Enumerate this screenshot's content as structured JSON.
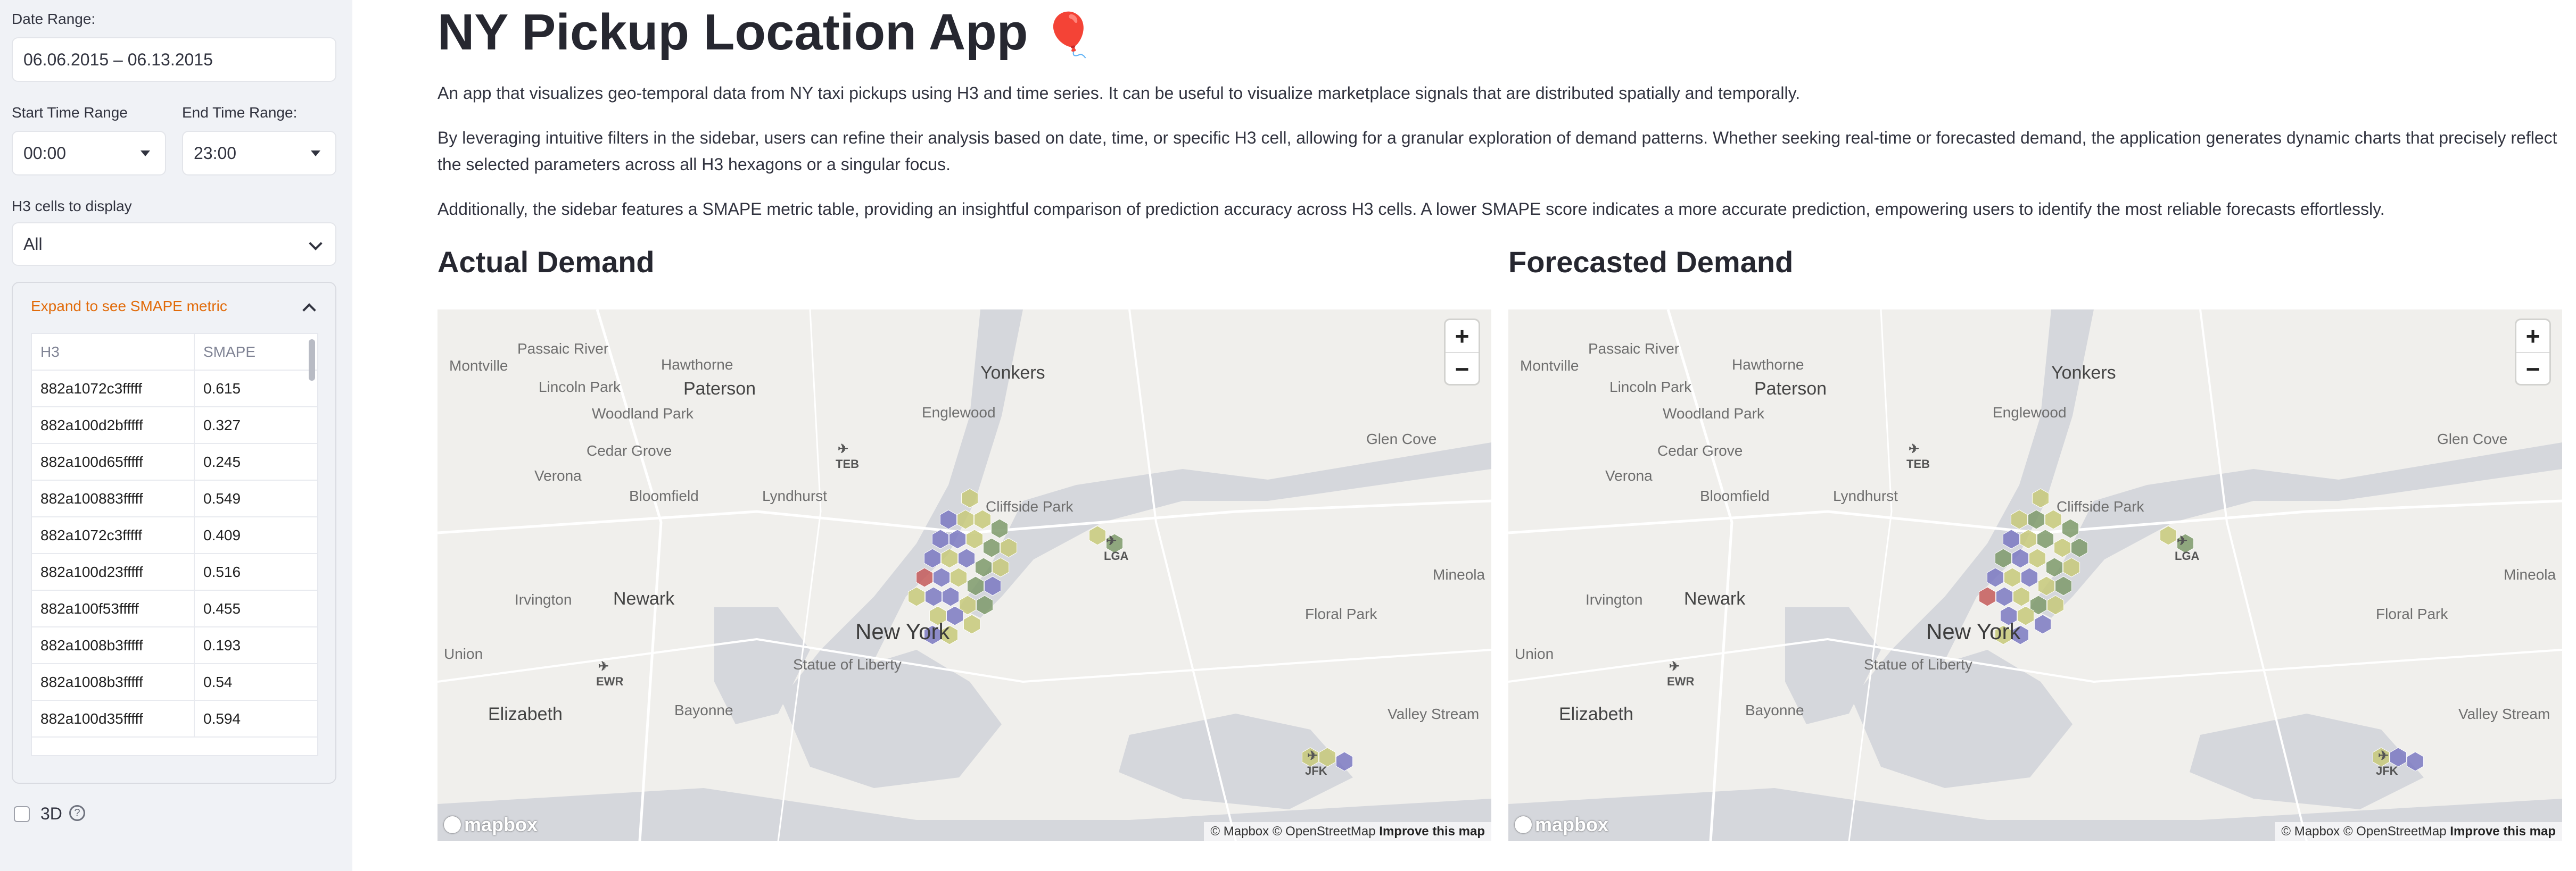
{
  "sidebar": {
    "date_range_label": "Date Range:",
    "date_range_value": "06.06.2015 – 06.13.2015",
    "start_time_label": "Start Time Range",
    "start_time_value": "00:00",
    "end_time_label": "End Time Range:",
    "end_time_value": "23:00",
    "h3_cells_label": "H3 cells to display",
    "h3_cells_value": "All",
    "expander_title": "Expand to see SMAPE metric",
    "table_headers": [
      "H3",
      "SMAPE"
    ],
    "table_rows": [
      [
        "882a1072c3fffff",
        "0.615"
      ],
      [
        "882a100d2bfffff",
        "0.327"
      ],
      [
        "882a100d65fffff",
        "0.245"
      ],
      [
        "882a100883fffff",
        "0.549"
      ],
      [
        "882a1072c3fffff",
        "0.409"
      ],
      [
        "882a100d23fffff",
        "0.516"
      ],
      [
        "882a100f53fffff",
        "0.455"
      ],
      [
        "882a1008b3fffff",
        "0.193"
      ],
      [
        "882a1008b3fffff",
        "0.54"
      ],
      [
        "882a100d35fffff",
        "0.594"
      ]
    ],
    "checkbox_3d_label": "3D",
    "checkbox_3d_checked": false
  },
  "main": {
    "title": "NY Pickup Location App",
    "title_emoji": "🎈",
    "paragraphs": [
      "An app that visualizes geo-temporal data from NY taxi pickups using H3 and time series. It can be useful to visualize marketplace signals that are distributed spatially and temporally.",
      "By leveraging intuitive filters in the sidebar, users can refine their analysis based on date, time, or specific H3 cell, allowing for a granular exploration of demand patterns. Whether seeking real-time or forecasted demand, the application generates dynamic charts that precisely reflect the selected parameters across all H3 hexagons or a singular focus.",
      "Additionally, the sidebar features a SMAPE metric table, providing an insightful comparison of prediction accuracy across H3 cells. A lower SMAPE score indicates a more accurate prediction, empowering users to identify the most reliable forecasts effortlessly."
    ],
    "actual_heading": "Actual Demand",
    "forecast_heading": "Forecasted Demand"
  },
  "map": {
    "zoom_in": "+",
    "zoom_out": "−",
    "attribution_text": "© Mapbox © OpenStreetMap",
    "improve_link": "Improve this map",
    "logo_text": "mapbox",
    "places": {
      "montville": "Montville",
      "passaic": "Passaic River",
      "lincoln_park": "Lincoln Park",
      "paterson": "Paterson",
      "woodland_park": "Woodland Park",
      "hawthorne": "Hawthorne",
      "yonkers": "Yonkers",
      "englewood": "Englewood",
      "cedar_grove": "Cedar Grove",
      "bloomfield": "Bloomfield",
      "lyndhurst": "Lyndhurst",
      "verona": "Verona",
      "cliffside_park": "Cliffside Park",
      "glen_cove": "Glen Cove",
      "teb": "TEB",
      "newark": "Newark",
      "irvington": "Irvington",
      "new_york": "New York",
      "lga": "LGA",
      "mineola": "Mineola",
      "floral_park": "Floral Park",
      "union": "Union",
      "ewr": "EWR",
      "statue": "Statue of Liberty",
      "elizabeth": "Elizabeth",
      "bayonne": "Bayonne",
      "valley_stream": "Valley Stream",
      "jfk": "JFK"
    }
  },
  "colors": {
    "hex_olive": "#c7c97a",
    "hex_purple": "#7b79c2",
    "hex_green": "#7e9a6b",
    "hex_red": "#c45a5a",
    "expander_title": "#e16b0a"
  }
}
